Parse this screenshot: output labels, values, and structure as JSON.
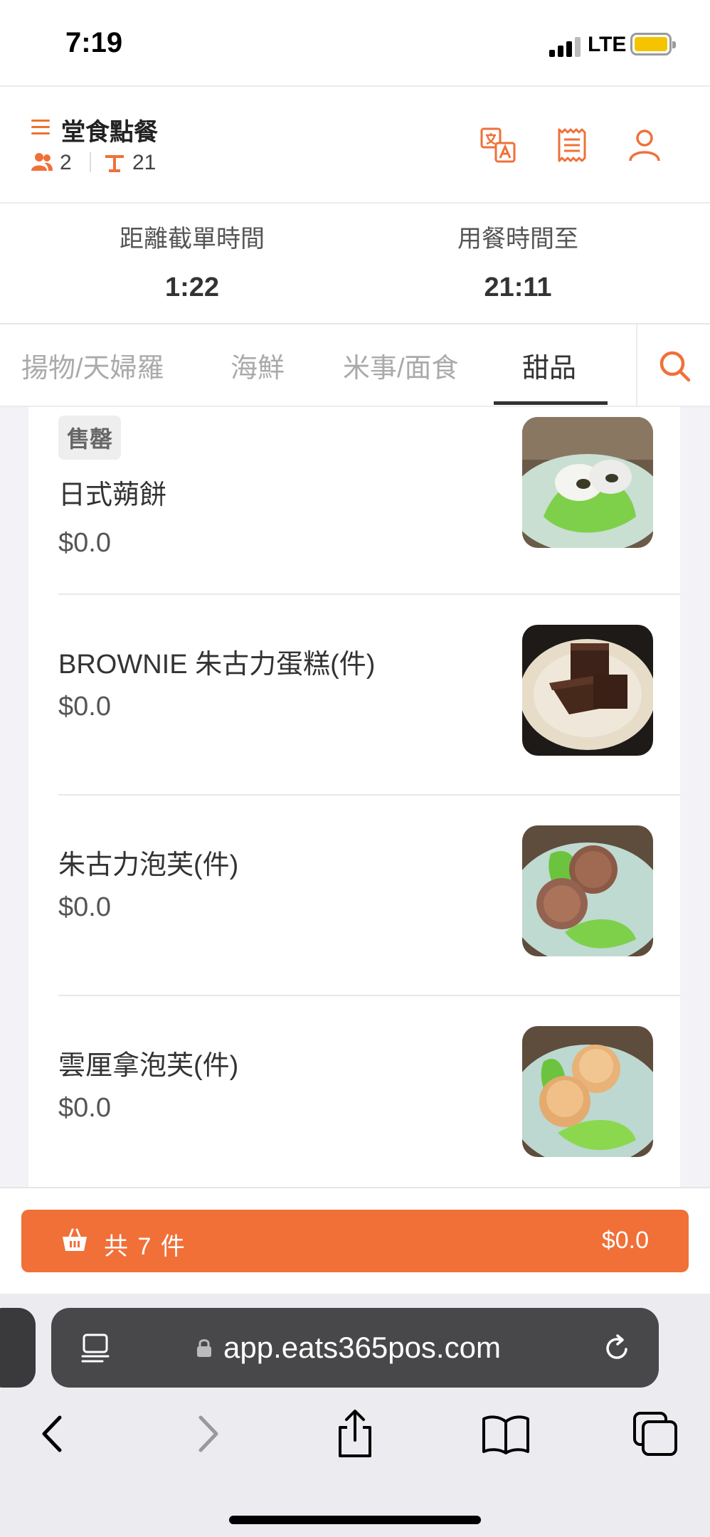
{
  "status_bar": {
    "time": "7:19",
    "network": "LTE"
  },
  "header": {
    "title": "堂食點餐",
    "guests": "2",
    "table": "21",
    "icons": [
      "translate-icon",
      "receipt-icon",
      "user-icon"
    ]
  },
  "timers": {
    "cutoff_label": "距離截單時間",
    "cutoff_value": "1:22",
    "dining_label": "用餐時間至",
    "dining_value": "21:11"
  },
  "tabs": [
    {
      "label": "揚物/天婦羅",
      "active": false
    },
    {
      "label": "海鮮",
      "active": false
    },
    {
      "label": "米事/面食",
      "active": false
    },
    {
      "label": "甜品",
      "active": true
    }
  ],
  "menu_items": [
    {
      "badge": "售罄",
      "name": "日式蒴餅",
      "price": "$0.0",
      "image": "mochi-dessert"
    },
    {
      "name": "BROWNIE 朱古力蛋糕(件)",
      "price": "$0.0",
      "image": "brownie"
    },
    {
      "name": "朱古力泡芙(件)",
      "price": "$0.0",
      "image": "chocolate-puffs"
    },
    {
      "name": "雲厘拿泡芙(件)",
      "price": "$0.0",
      "image": "vanilla-puffs"
    }
  ],
  "cart": {
    "count_label": "共 7 件",
    "total": "$0.0"
  },
  "browser": {
    "url": "app.eats365pos.com"
  },
  "colors": {
    "accent": "#f07038",
    "text": "#333333"
  }
}
